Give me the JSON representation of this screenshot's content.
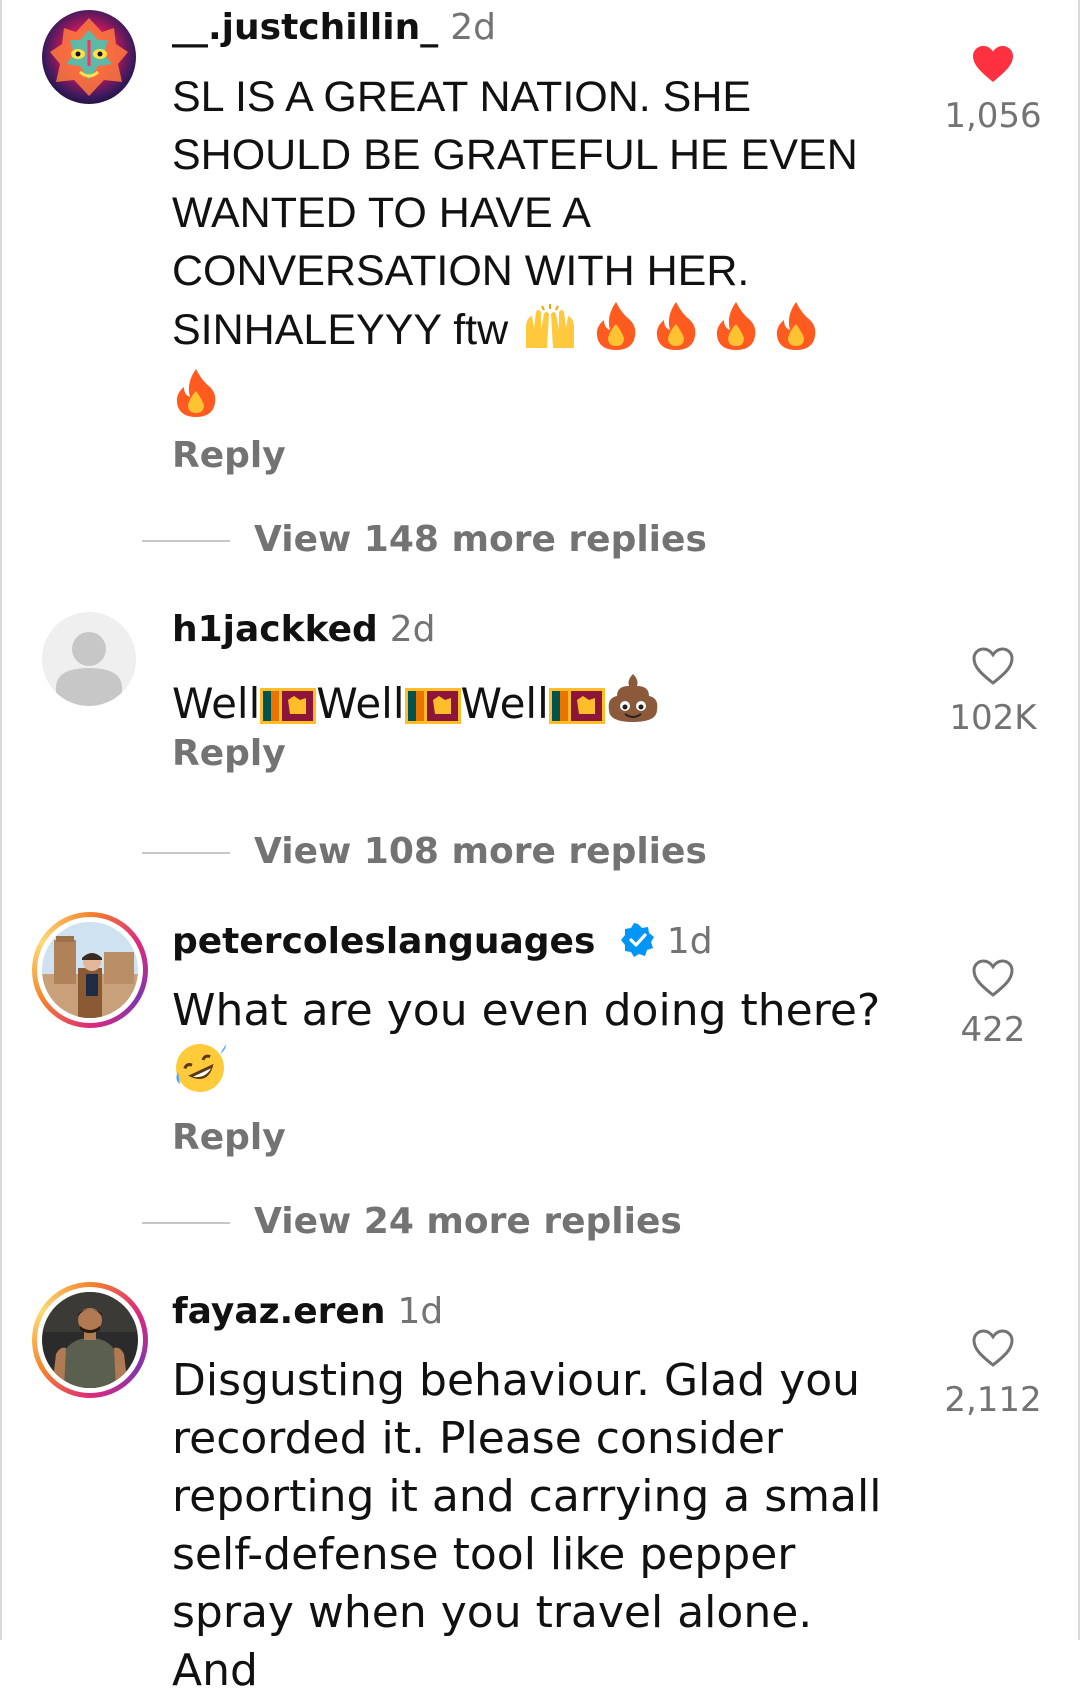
{
  "comments": [
    {
      "username": "__.justchillin_",
      "time": "2d",
      "text": "SL IS A GREAT NATION. SHE SHOULD BE GRATEFUL HE EVEN WANTED TO HAVE A CONVERSATION WITH HER. SINHALEYYY ftw",
      "emoji_after": [
        "raised-hands-emoji",
        "fire-emoji",
        "fire-emoji",
        "fire-emoji",
        "fire-emoji",
        "fire-emoji"
      ],
      "reply_label": "Reply",
      "view_replies_label": "View 148 more replies",
      "likes": "1,056",
      "liked": true,
      "avatar_icon": "colorful-mask-avatar"
    },
    {
      "username": "h1jackked",
      "time": "2d",
      "text_parts": [
        "Well",
        "Well",
        "Well"
      ],
      "emoji_after": [
        "sri-lanka-flag-emoji",
        "pile-of-poo-emoji"
      ],
      "reply_label": "Reply",
      "view_replies_label": "View 108 more replies",
      "likes": "102K",
      "liked": false,
      "avatar_icon": "default-user-avatar"
    },
    {
      "username": "petercoleslanguages",
      "time": "1d",
      "verified": true,
      "text": "What are you even doing there?",
      "emoji_after": [
        "rolling-on-floor-laughing-emoji"
      ],
      "reply_label": "Reply",
      "view_replies_label": "View 24 more replies",
      "likes": "422",
      "liked": false,
      "avatar_icon": "man-in-front-of-building-photo"
    },
    {
      "username": "fayaz.eren",
      "time": "1d",
      "text": "Disgusting behaviour. Glad you recorded it. Please consider reporting it and carrying a small self-defense tool like pepper spray when you travel alone. And",
      "likes": "2,112",
      "liked": false,
      "avatar_icon": "muscular-man-photo"
    }
  ],
  "colors": {
    "like_red": "#ff3040",
    "muted_gray": "#737373",
    "verified_blue": "#0095f6"
  }
}
